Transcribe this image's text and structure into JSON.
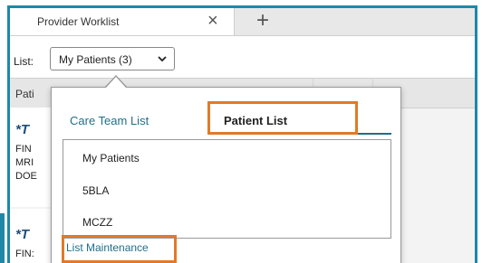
{
  "tab": {
    "title": "Provider Worklist",
    "close_icon": "×",
    "add_icon": "+"
  },
  "listbar": {
    "label": "List:",
    "selected": "My Patients (3)"
  },
  "table": {
    "header_partial": "Pati"
  },
  "rows_partial": [
    {
      "star": "*T",
      "fin": "FIN",
      "mrn": "MRI",
      "dob": "DOE"
    },
    {
      "star": "*T",
      "fin": "FIN: "
    }
  ],
  "popup": {
    "tabs": {
      "care_team": "Care Team List",
      "patient": "Patient List"
    },
    "items": [
      "My Patients",
      "5BLA",
      "MCZZ"
    ],
    "maintenance": "List Maintenance"
  },
  "colors": {
    "accent": "#1e88a8",
    "highlight": "#e07a2a",
    "link": "#1e6f8a"
  }
}
